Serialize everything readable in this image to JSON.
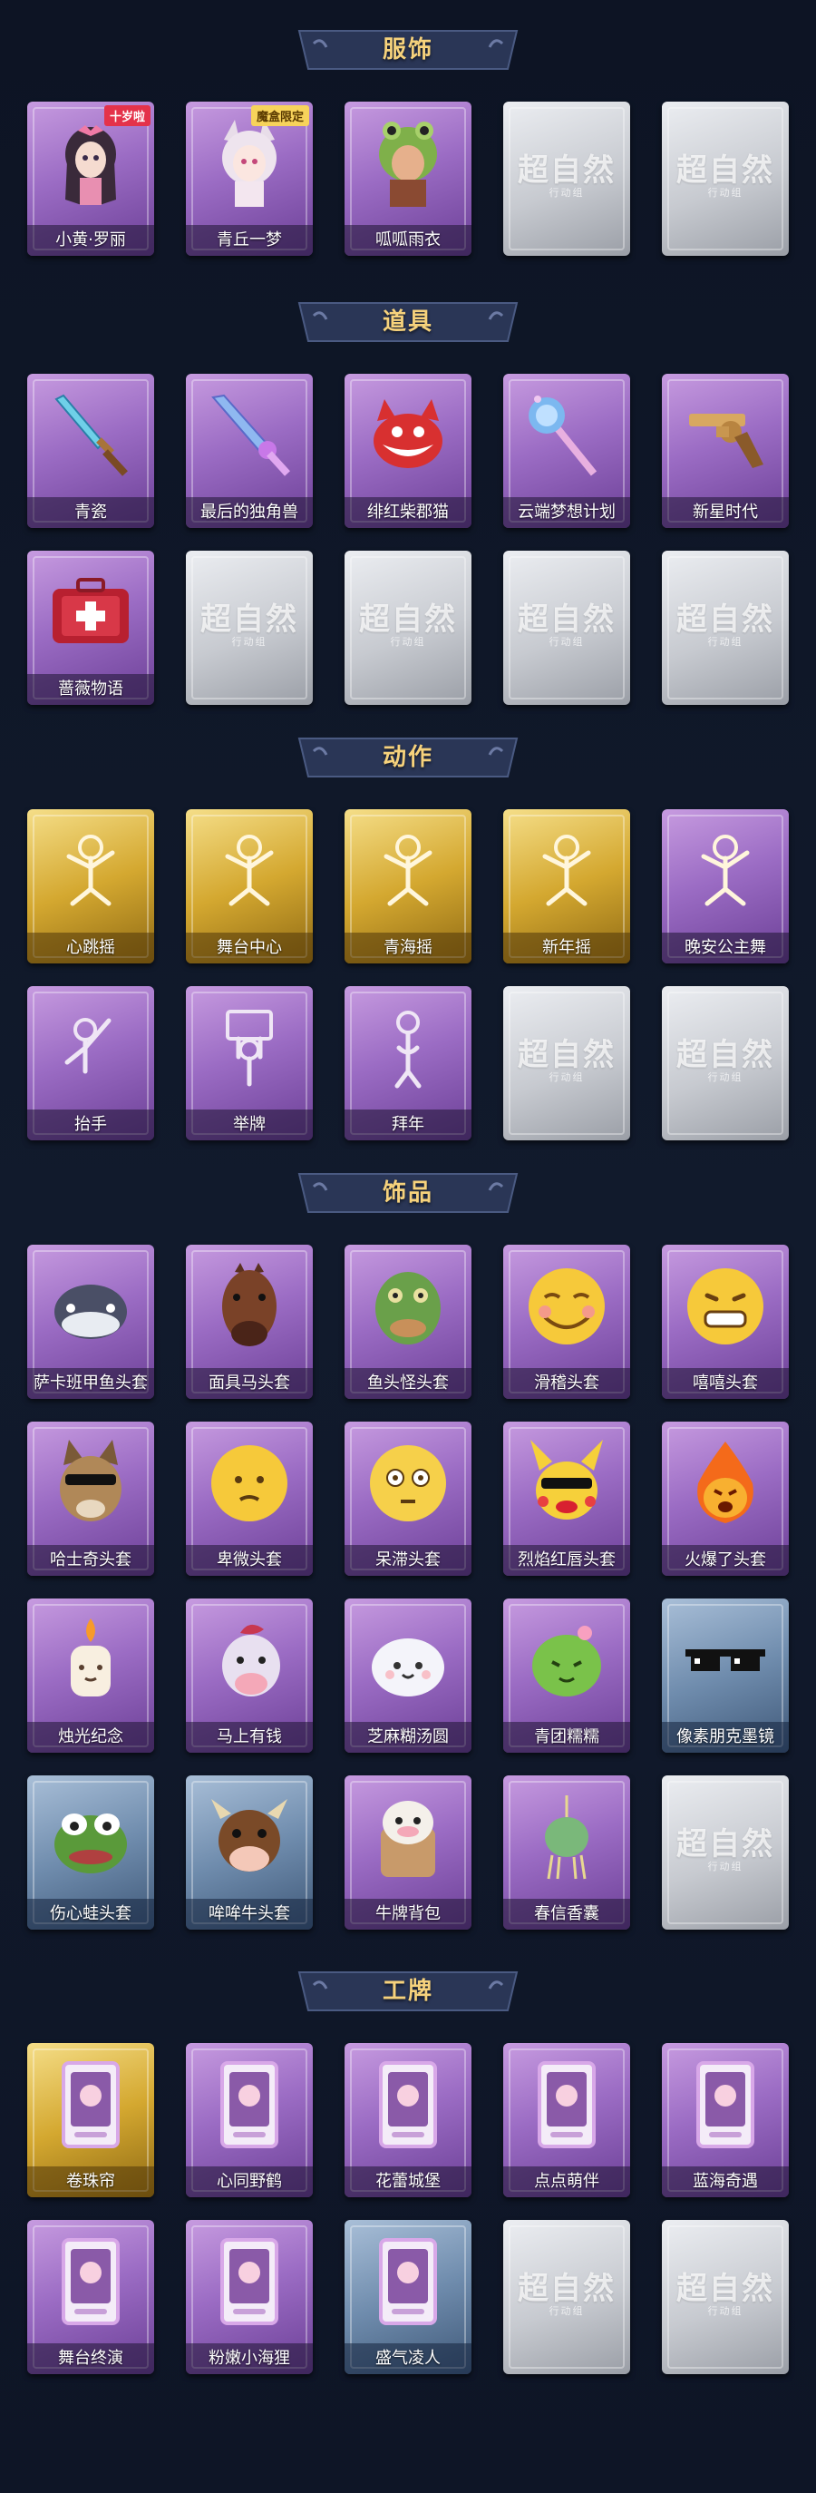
{
  "sections": [
    {
      "title": "服饰",
      "items": [
        {
          "label": "小黄·罗丽",
          "tier": "purple",
          "icon": "girl-costume-icon",
          "tag": "十岁啦",
          "tag_style": "red"
        },
        {
          "label": "青丘一梦",
          "tier": "purple",
          "icon": "fox-girl-costume-icon",
          "tag": "魔盒限定",
          "tag_style": "gold"
        },
        {
          "label": "呱呱雨衣",
          "tier": "purple",
          "icon": "frog-raincoat-costume-icon"
        },
        {
          "label": "",
          "tier": "locked",
          "icon": "locked-placeholder-icon"
        },
        {
          "label": "",
          "tier": "locked",
          "icon": "locked-placeholder-icon"
        }
      ]
    },
    {
      "title": "道具",
      "items": [
        {
          "label": "青瓷",
          "tier": "purple",
          "icon": "sword-icon"
        },
        {
          "label": "最后的独角兽",
          "tier": "purple",
          "icon": "unicorn-sword-icon"
        },
        {
          "label": "绯红柴郡猫",
          "tier": "purple",
          "icon": "cheshire-cat-icon"
        },
        {
          "label": "云端梦想计划",
          "tier": "purple",
          "icon": "magic-wand-icon"
        },
        {
          "label": "新星时代",
          "tier": "purple",
          "icon": "revolver-icon"
        },
        {
          "label": "蔷薇物语",
          "tier": "purple",
          "icon": "medkit-icon"
        },
        {
          "label": "",
          "tier": "locked",
          "icon": "locked-placeholder-icon"
        },
        {
          "label": "",
          "tier": "locked",
          "icon": "locked-placeholder-icon"
        },
        {
          "label": "",
          "tier": "locked",
          "icon": "locked-placeholder-icon"
        },
        {
          "label": "",
          "tier": "locked",
          "icon": "locked-placeholder-icon"
        }
      ]
    },
    {
      "title": "动作",
      "items": [
        {
          "label": "心跳摇",
          "tier": "gold",
          "icon": "dance-pose-icon"
        },
        {
          "label": "舞台中心",
          "tier": "gold",
          "icon": "dance-pose-icon"
        },
        {
          "label": "青海摇",
          "tier": "gold",
          "icon": "dance-pose-icon"
        },
        {
          "label": "新年摇",
          "tier": "gold",
          "icon": "dance-pose-icon"
        },
        {
          "label": "晚安公主舞",
          "tier": "purple",
          "icon": "dance-pose-icon"
        },
        {
          "label": "抬手",
          "tier": "purple",
          "icon": "raise-hand-pose-icon"
        },
        {
          "label": "举牌",
          "tier": "purple",
          "icon": "hold-sign-pose-icon"
        },
        {
          "label": "拜年",
          "tier": "purple",
          "icon": "bow-pose-icon"
        },
        {
          "label": "",
          "tier": "locked",
          "icon": "locked-placeholder-icon"
        },
        {
          "label": "",
          "tier": "locked",
          "icon": "locked-placeholder-icon"
        }
      ]
    },
    {
      "title": "饰品",
      "items": [
        {
          "label": "萨卡班甲鱼头套",
          "tier": "purple",
          "icon": "fish-head-icon"
        },
        {
          "label": "面具马头套",
          "tier": "purple",
          "icon": "horse-head-icon"
        },
        {
          "label": "鱼头怪头套",
          "tier": "purple",
          "icon": "fish-monster-head-icon"
        },
        {
          "label": "滑稽头套",
          "tier": "purple",
          "icon": "funny-face-icon"
        },
        {
          "label": "嘻嘻头套",
          "tier": "purple",
          "icon": "grin-face-icon"
        },
        {
          "label": "哈士奇头套",
          "tier": "purple",
          "icon": "husky-head-icon"
        },
        {
          "label": "卑微头套",
          "tier": "purple",
          "icon": "humble-face-icon"
        },
        {
          "label": "呆滞头套",
          "tier": "purple",
          "icon": "dazed-face-icon"
        },
        {
          "label": "烈焰红唇头套",
          "tier": "purple",
          "icon": "pikachu-head-icon"
        },
        {
          "label": "火爆了头套",
          "tier": "purple",
          "icon": "fire-face-icon"
        },
        {
          "label": "烛光纪念",
          "tier": "purple",
          "icon": "candle-icon"
        },
        {
          "label": "马上有钱",
          "tier": "purple",
          "icon": "pony-head-icon"
        },
        {
          "label": "芝麻糊汤圆",
          "tier": "purple",
          "icon": "dumpling-icon"
        },
        {
          "label": "青团糯糯",
          "tier": "purple",
          "icon": "green-dumpling-icon"
        },
        {
          "label": "像素朋克墨镜",
          "tier": "blue",
          "icon": "pixel-sunglasses-icon"
        },
        {
          "label": "伤心蛙头套",
          "tier": "blue",
          "icon": "sad-frog-head-icon"
        },
        {
          "label": "哞哞牛头套",
          "tier": "blue",
          "icon": "cow-head-icon"
        },
        {
          "label": "牛牌背包",
          "tier": "purple",
          "icon": "cow-backpack-icon"
        },
        {
          "label": "春信香囊",
          "tier": "purple",
          "icon": "sachet-icon"
        },
        {
          "label": "",
          "tier": "locked",
          "icon": "locked-placeholder-icon"
        }
      ]
    },
    {
      "title": "工牌",
      "items": [
        {
          "label": "卷珠帘",
          "tier": "gold",
          "icon": "badge-card-icon"
        },
        {
          "label": "心同野鹤",
          "tier": "purple",
          "icon": "badge-card-icon"
        },
        {
          "label": "花蕾城堡",
          "tier": "purple",
          "icon": "badge-card-icon"
        },
        {
          "label": "点点萌伴",
          "tier": "purple",
          "icon": "badge-card-icon"
        },
        {
          "label": "蓝海奇遇",
          "tier": "purple",
          "icon": "badge-card-icon"
        },
        {
          "label": "舞台终演",
          "tier": "purple",
          "icon": "badge-card-icon"
        },
        {
          "label": "粉嫩小海狸",
          "tier": "purple",
          "icon": "badge-card-icon"
        },
        {
          "label": "盛气凌人",
          "tier": "blue",
          "icon": "badge-card-icon"
        },
        {
          "label": "",
          "tier": "locked",
          "icon": "locked-placeholder-icon"
        },
        {
          "label": "",
          "tier": "locked",
          "icon": "locked-placeholder-icon"
        }
      ]
    }
  ],
  "placeholder": {
    "title": "超自然",
    "subtitle": "行动组"
  },
  "colors": {
    "background": "#0e1526",
    "banner_fill": "#2a3656",
    "banner_title": "#f6d27c",
    "purple": "#9b6cc4",
    "gold": "#d4a830",
    "blue": "#6f8cad",
    "locked": "#c7cad0"
  }
}
